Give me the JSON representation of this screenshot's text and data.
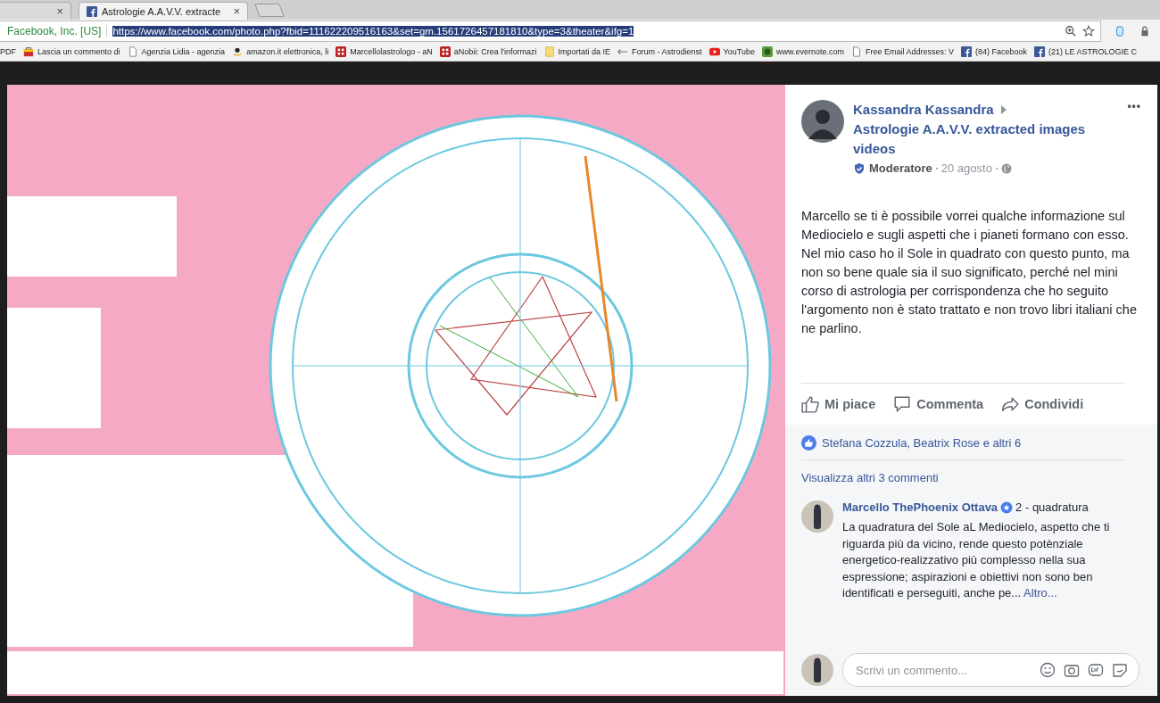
{
  "browser": {
    "tabs": [
      {
        "close": "×",
        "selected": false
      },
      {
        "title": "Astrologie A.A.V.V. extracte",
        "close": "×",
        "selected": true
      }
    ],
    "address": {
      "site": "Facebook, Inc. [US]",
      "url": "https://www.facebook.com/photo.php?fbid=111622209516163&set=gm.1561726457181810&type=3&theater&ifg=1",
      "url_selected": true
    },
    "bookmarks": [
      {
        "label": "PDF",
        "kind": "none"
      },
      {
        "label": "Lascia un commento di",
        "kind": "bag"
      },
      {
        "label": "Agenzia Lidia - agenzia",
        "kind": "page"
      },
      {
        "label": "amazon.it elettronica, li",
        "kind": "amazon"
      },
      {
        "label": "Marcellolastrologo - aN",
        "kind": "grid"
      },
      {
        "label": "aNobii: Crea l'informazi",
        "kind": "grid"
      },
      {
        "label": "Importati da IE",
        "kind": "folder"
      },
      {
        "label": "Forum - Astrodienst",
        "kind": "arrow"
      },
      {
        "label": "YouTube",
        "kind": "youtube"
      },
      {
        "label": "www.evernote.com",
        "kind": "evernote"
      },
      {
        "label": "Free Email Addresses: V",
        "kind": "page"
      },
      {
        "label": "(84) Facebook",
        "kind": "facebook"
      },
      {
        "label": "(21) LE ASTROLOGIE C",
        "kind": "facebook"
      }
    ]
  },
  "post": {
    "author": "Kassandra Kassandra",
    "group": "Astrologie A.A.V.V. extracted images videos",
    "more": "•••",
    "role": "Moderatore",
    "date": "20 agosto",
    "body": "Marcello se ti è possibile vorrei qualche informazione sul Mediocielo e sugli aspetti che i pianeti formano con esso. Nel mio caso ho il Sole in quadrato con questo punto, ma non so bene quale sia il suo significato, perché nel mini corso di astrologia per corrispondenza che ho seguito l'argomento non è stato trattato e non trovo libri italiani che ne parlino.",
    "actions": [
      {
        "label": "Mi piace",
        "kind": "like"
      },
      {
        "label": "Commenta",
        "kind": "comment"
      },
      {
        "label": "Condividi",
        "kind": "share"
      }
    ],
    "likes": "Stefana Cozzula, Beatrix Rose e altri 6",
    "more_comments": "Visualizza altri 3 commenti",
    "comment": {
      "author": "Marcello ThePhoenix Ottava",
      "text": "2 - quadratura",
      "body": "La quadratura del Sole aL Mediocielo, aspetto che ti riguarda più da vicino, rende questo potènziale energetico-realizzativo più complesso nella sua espressione; aspirazioni e obiettivi non sono ben identificati e perseguiti, anche pe...",
      "link": "Altro..."
    },
    "composer": {
      "placeholder": "Scrivi un commento..."
    }
  }
}
